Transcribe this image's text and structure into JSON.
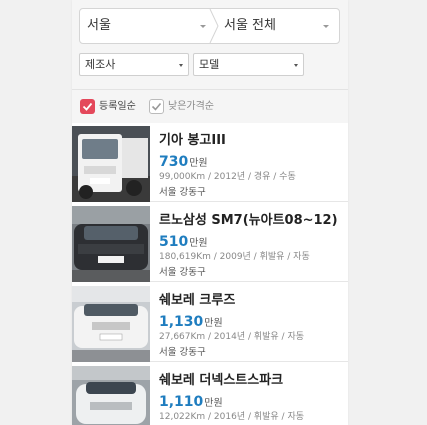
{
  "region": {
    "city": "서울",
    "district": "서울 전체"
  },
  "filters": {
    "maker": "제조사",
    "model": "모델"
  },
  "sort": {
    "registered": "등록일순",
    "low_price": "낮은가격순"
  },
  "listings": [
    {
      "title": "기아 봉고III",
      "price": "730",
      "unit": "만원",
      "spec": "99,000Km / 2012년 / 경유 / 수동",
      "location": "서울 강동구"
    },
    {
      "title": "르노삼성 SM7(뉴아트08~12)",
      "price": "510",
      "unit": "만원",
      "spec": "180,619Km / 2009년 / 휘발유 / 자동",
      "location": "서울 강동구"
    },
    {
      "title": "쉐보레 크루즈",
      "price": "1,130",
      "unit": "만원",
      "spec": "27,667Km / 2014년 / 휘발유 / 자동",
      "location": "서울 강동구"
    },
    {
      "title": "쉐보레 더넥스트스파크",
      "price": "1,110",
      "unit": "만원",
      "spec": "12,022Km / 2016년 / 휘발유 / 자동",
      "location": ""
    }
  ],
  "colors": {
    "accent_check": "#e4485b",
    "price_blue": "#1f7dbf"
  }
}
